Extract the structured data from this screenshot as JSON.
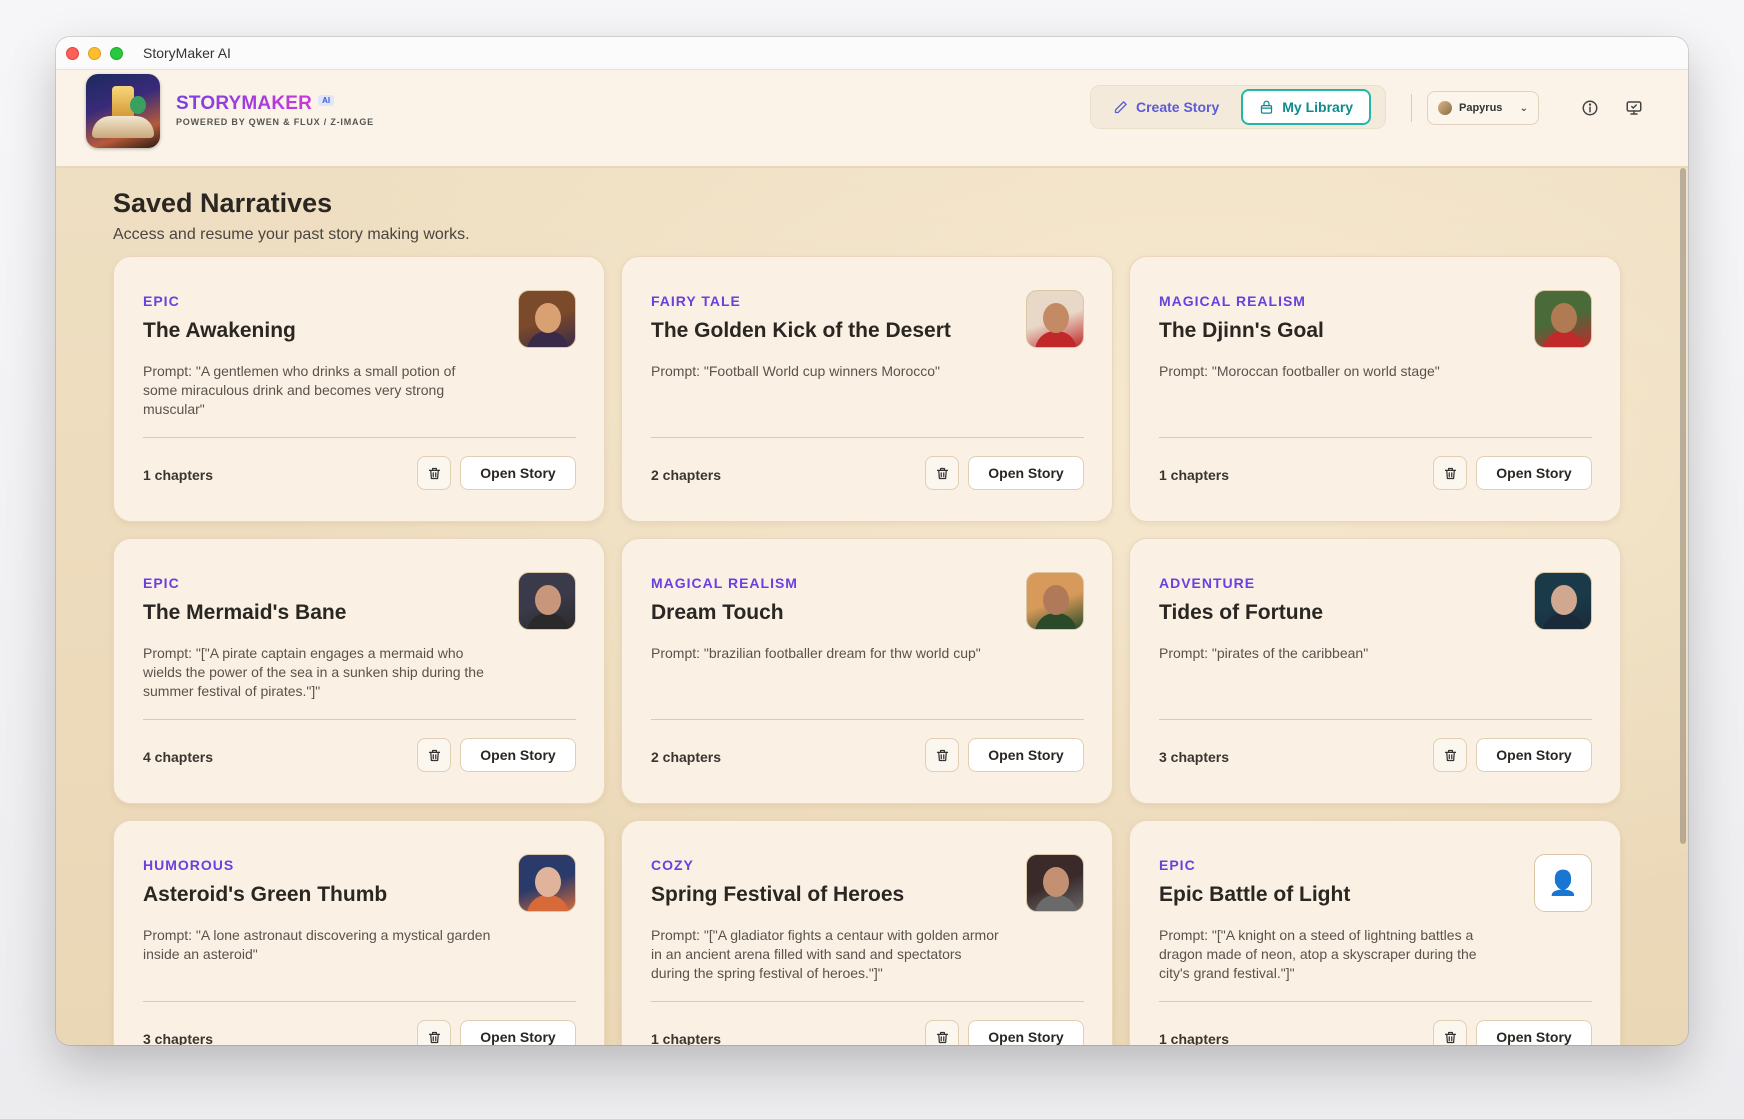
{
  "window": {
    "title": "StoryMaker AI"
  },
  "brand": {
    "name": "STORYMAKER",
    "badge": "AI",
    "subtitle": "POWERED BY QWEN & FLUX / Z-IMAGE"
  },
  "nav": {
    "create_label": "Create Story",
    "library_label": "My Library"
  },
  "theme": {
    "selected": "Papyrus"
  },
  "page": {
    "title": "Saved Narratives",
    "subtitle": "Access and resume your past story making works."
  },
  "labels": {
    "open_story": "Open Story"
  },
  "stories": [
    {
      "genre": "EPIC",
      "title": "The Awakening",
      "prompt": "Prompt: \"A gentlemen who drinks a small potion of some miraculous drink and becomes very strong muscular\"",
      "chapters": "1 chapters",
      "thumb": [
        "#7a4a2a",
        "#d9a072",
        "#3a2a4a"
      ]
    },
    {
      "genre": "FAIRY TALE",
      "title": "The Golden Kick of the Desert",
      "prompt": "Prompt: \"Football World cup winners Morocco\"",
      "chapters": "2 chapters",
      "thumb": [
        "#e8d8c8",
        "#c48a64",
        "#c0282a"
      ]
    },
    {
      "genre": "MAGICAL REALISM",
      "title": "The Djinn's Goal",
      "prompt": "Prompt: \"Moroccan footballer on world stage\"",
      "chapters": "1 chapters",
      "thumb": [
        "#4a6a3a",
        "#b07a52",
        "#c02a2a"
      ]
    },
    {
      "genre": "EPIC",
      "title": "The Mermaid's Bane",
      "prompt": "Prompt: \"[\"A pirate captain engages a mermaid who wields the power of the sea in a sunken ship during the summer festival of pirates.\"]\"",
      "chapters": "4 chapters",
      "thumb": [
        "#3a3a4a",
        "#c8967a",
        "#2a2a2a"
      ]
    },
    {
      "genre": "MAGICAL REALISM",
      "title": "Dream Touch",
      "prompt": "Prompt: \"brazilian footballer dream for thw world cup\"",
      "chapters": "2 chapters",
      "thumb": [
        "#d89a5a",
        "#b07a5a",
        "#2a4a2a"
      ]
    },
    {
      "genre": "ADVENTURE",
      "title": "Tides of Fortune",
      "prompt": "Prompt: \"pirates of the caribbean\"",
      "chapters": "3 chapters",
      "thumb": [
        "#1a3a4a",
        "#d0a890",
        "#1a2a3a"
      ]
    },
    {
      "genre": "HUMOROUS",
      "title": "Asteroid's Green Thumb",
      "prompt": "Prompt: \"A lone astronaut discovering a mystical garden inside an asteroid\"",
      "chapters": "3 chapters",
      "thumb": [
        "#2a3a6a",
        "#e0b49a",
        "#d86a3a"
      ]
    },
    {
      "genre": "COZY",
      "title": "Spring Festival of Heroes",
      "prompt": "Prompt: \"[\"A gladiator fights a centaur with golden armor in an ancient arena filled with sand and spectators during the spring festival of heroes.\"]\"",
      "chapters": "1 chapters",
      "thumb": [
        "#3a2a2a",
        "#c49072",
        "#6a6a6a"
      ]
    },
    {
      "genre": "EPIC",
      "title": "Epic Battle of Light",
      "prompt": "Prompt: \"[\"A knight on a steed of lightning battles a dragon made of neon, atop a skyscraper during the city's grand festival.\"]\"",
      "chapters": "1 chapters",
      "thumb": null
    }
  ]
}
